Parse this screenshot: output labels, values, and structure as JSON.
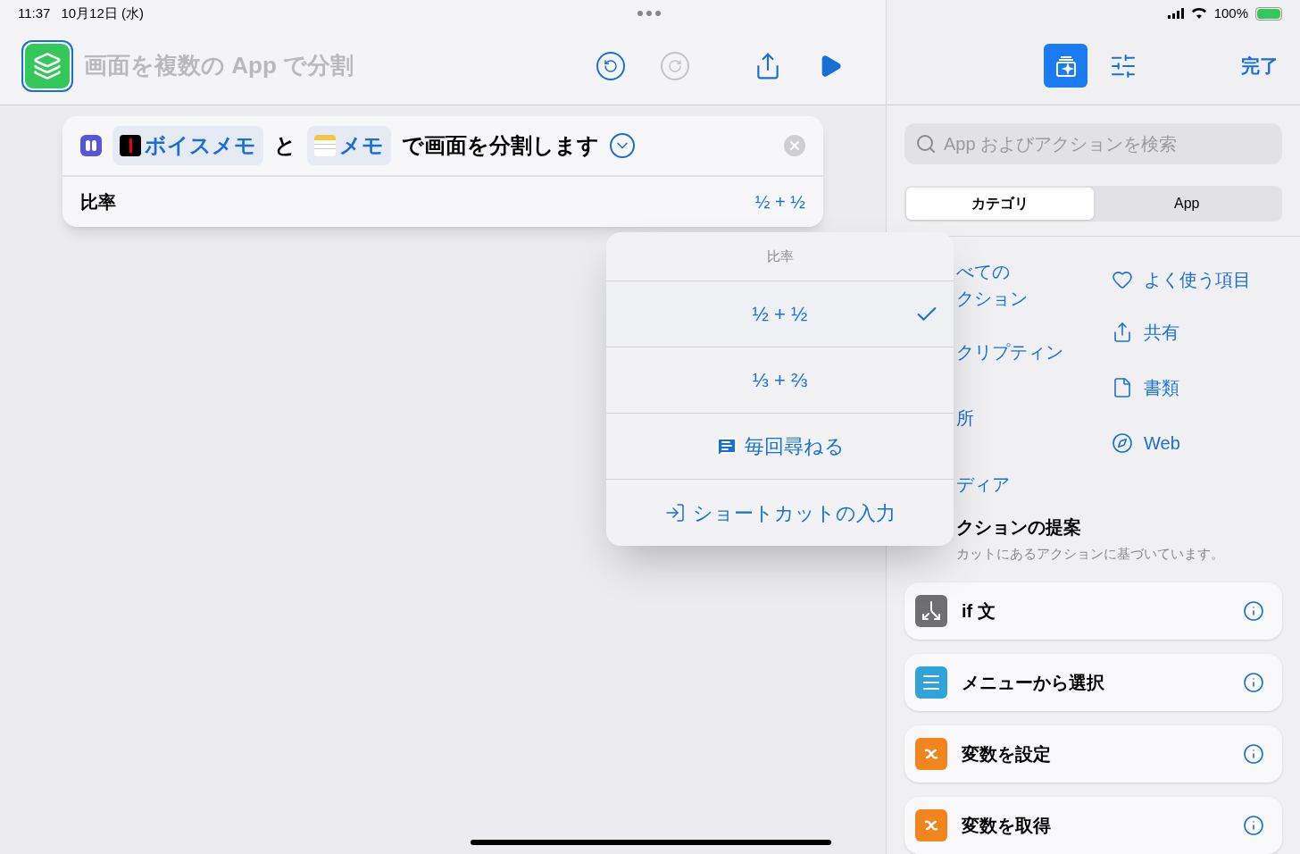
{
  "status_bar": {
    "time": "11:37",
    "date": "10月12日 (水)",
    "battery": "100%"
  },
  "toolbar": {
    "title": "画面を複数の App で分割",
    "done": "完了"
  },
  "action": {
    "segments": [
      {
        "kind": "voice",
        "text": "ボイスメモ"
      },
      {
        "kind": "text",
        "text": "と"
      },
      {
        "kind": "notes",
        "text": "メモ"
      },
      {
        "kind": "text",
        "text": "で画面を分割します"
      }
    ],
    "param_label": "比率",
    "param_value": "½ + ½"
  },
  "popover": {
    "title": "比率",
    "options": [
      {
        "kind": "value",
        "label": "½ + ½",
        "selected": true
      },
      {
        "kind": "value",
        "label": "⅓ + ⅔",
        "selected": false
      },
      {
        "kind": "ask",
        "label": "毎回尋ねる",
        "selected": false
      },
      {
        "kind": "input",
        "label": "ショートカットの入力",
        "selected": false
      }
    ]
  },
  "search": {
    "placeholder": "App およびアクションを検索"
  },
  "tabs": [
    {
      "label": "カテゴリ",
      "selected": true
    },
    {
      "label": "App",
      "selected": false
    }
  ],
  "categories_left": [
    {
      "lines": [
        "べての",
        "クション"
      ]
    },
    {
      "lines": [
        "クリプティン"
      ]
    },
    {
      "lines": [
        "所"
      ]
    },
    {
      "lines": [
        "ディア"
      ]
    }
  ],
  "categories_right": [
    {
      "kind": "heart",
      "label": "よく使う項目"
    },
    {
      "kind": "share",
      "label": "共有"
    },
    {
      "kind": "document",
      "label": "書類"
    },
    {
      "kind": "compass",
      "label": "Web"
    }
  ],
  "suggestions": {
    "title": "クションの提案",
    "subtitle": "カットにあるアクションに基づいています。",
    "items": [
      {
        "kind": "branch",
        "color": "#6e6e73",
        "label": "if 文"
      },
      {
        "kind": "menu",
        "color": "#32a3d8",
        "label": "メニューから選択"
      },
      {
        "kind": "variable",
        "color": "#f2851e",
        "label": "変数を設定"
      },
      {
        "kind": "variable",
        "color": "#f2851e",
        "label": "変数を取得"
      }
    ]
  }
}
